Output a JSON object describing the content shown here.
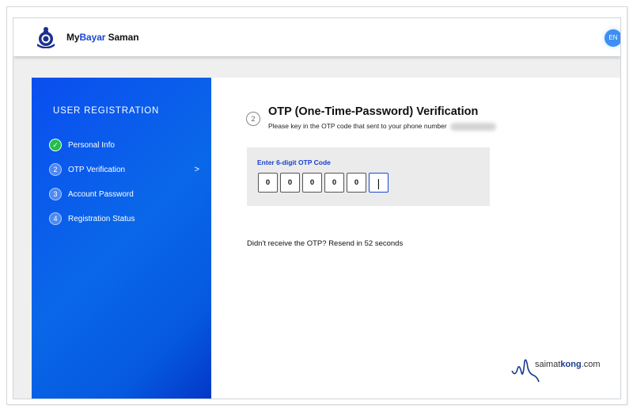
{
  "header": {
    "brand_prefix": "My",
    "brand_accent": "Bayar",
    "brand_suffix": " Saman",
    "logo_icon": "police-crest-icon",
    "language_button": "EN"
  },
  "sidebar": {
    "title": "USER REGISTRATION",
    "steps": [
      {
        "number": "✓",
        "label": "Personal Info",
        "status": "completed"
      },
      {
        "number": "2",
        "label": "OTP Verification",
        "status": "current",
        "chevron": ">"
      },
      {
        "number": "3",
        "label": "Account Password",
        "status": "pending"
      },
      {
        "number": "4",
        "label": "Registration Status",
        "status": "pending"
      }
    ]
  },
  "main": {
    "step_number": "2",
    "title": "OTP (One-Time-Password) Verification",
    "subtitle": "Please key in the OTP code that sent to your phone number",
    "otp": {
      "label": "Enter 6-digit OTP Code",
      "digits": [
        "0",
        "0",
        "0",
        "0",
        "0",
        ""
      ],
      "cursor": "|"
    },
    "resend_text": "Didn't receive the OTP? Resend in 52 seconds"
  },
  "watermark": {
    "prefix": "saimat",
    "accent": "kong",
    "suffix": ".com"
  },
  "colors": {
    "brand_blue": "#1a47d6",
    "sidebar_blue": "#0a5ce8",
    "success_green": "#22c04a",
    "lang_button": "#3d8ff5"
  }
}
